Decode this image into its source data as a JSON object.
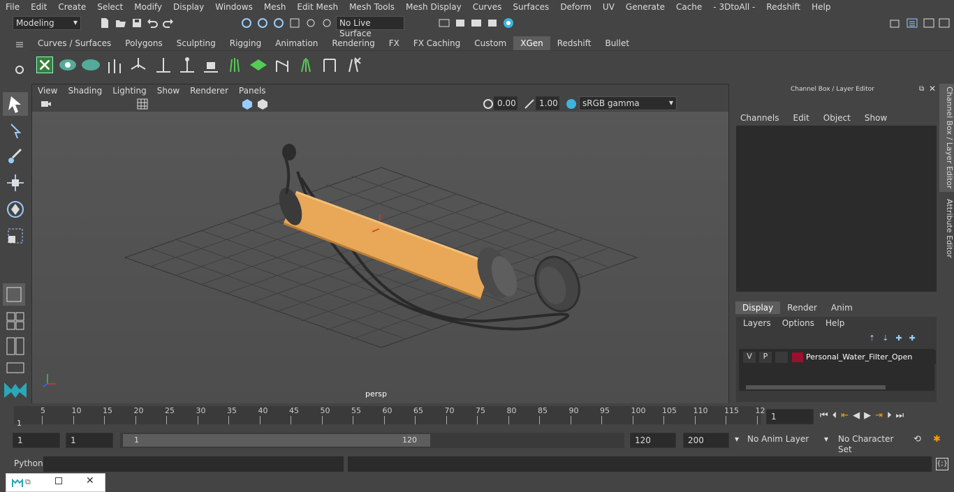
{
  "menu": [
    "File",
    "Edit",
    "Create",
    "Select",
    "Modify",
    "Display",
    "Windows",
    "Mesh",
    "Edit Mesh",
    "Mesh Tools",
    "Mesh Display",
    "Curves",
    "Surfaces",
    "Deform",
    "UV",
    "Generate",
    "Cache",
    "- 3DtoAll -",
    "Redshift",
    "Help"
  ],
  "toolbar": {
    "mode_select": "Modeling",
    "live_surface": "No Live Surface"
  },
  "shelf_tabs": [
    "Curves / Surfaces",
    "Polygons",
    "Sculpting",
    "Rigging",
    "Animation",
    "Rendering",
    "FX",
    "FX Caching",
    "Custom",
    "XGen",
    "Redshift",
    "Bullet"
  ],
  "active_shelf": "XGen",
  "viewport": {
    "menu": [
      "View",
      "Shading",
      "Lighting",
      "Show",
      "Renderer",
      "Panels"
    ],
    "exposure": "0.00",
    "gamma": "1.00",
    "color_space": "sRGB gamma",
    "camera_label": "persp"
  },
  "channel_box": {
    "title": "Channel Box / Layer Editor",
    "menu": [
      "Channels",
      "Edit",
      "Object",
      "Show"
    ]
  },
  "layer_editor": {
    "tabs": [
      "Display",
      "Render",
      "Anim"
    ],
    "active_tab": "Display",
    "menu": [
      "Layers",
      "Options",
      "Help"
    ],
    "layer": {
      "v": "V",
      "p": "P",
      "name": "Personal_Water_Filter_Open",
      "color": "#9b1030"
    }
  },
  "side_tabs": [
    "Channel Box / Layer Editor",
    "Attribute Editor"
  ],
  "timeline": {
    "ticks": [
      "5",
      "10",
      "15",
      "20",
      "25",
      "30",
      "35",
      "40",
      "45",
      "50",
      "55",
      "60",
      "65",
      "70",
      "75",
      "80",
      "85",
      "90",
      "95",
      "100",
      "105",
      "110",
      "115",
      "12"
    ],
    "start_marker": "1",
    "current_frame": "1"
  },
  "range": {
    "start": "1",
    "anim_start": "1",
    "slider_start": "1",
    "slider_end": "120",
    "anim_end": "120",
    "end": "200",
    "anim_layer": "No Anim Layer",
    "char_set": "No Character Set"
  },
  "command": {
    "label": "Python"
  },
  "colors": {
    "bg": "#444444",
    "accent": "#5d5d5d",
    "object": "#e8a857"
  }
}
